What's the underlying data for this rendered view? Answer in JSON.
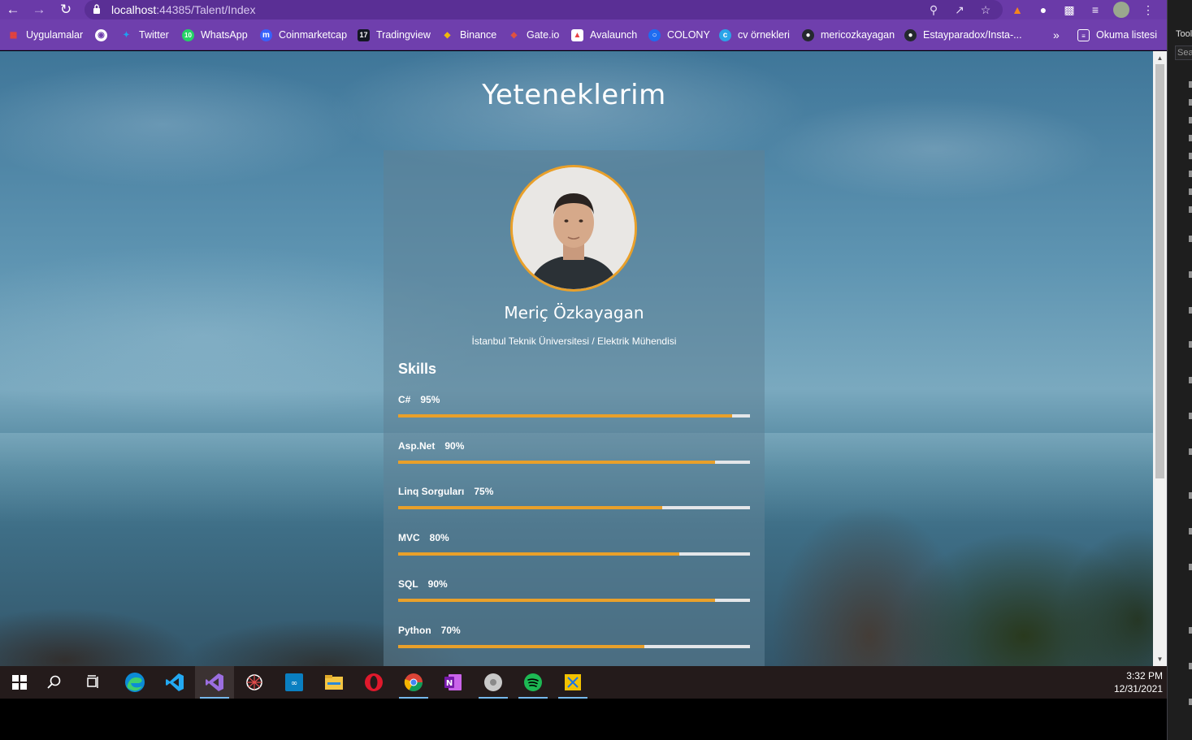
{
  "browser": {
    "url_host": "localhost",
    "url_rest": ":44385/Talent/Index",
    "bookmarks": [
      {
        "label": "Uygulamalar",
        "icon": "apps-grid-icon",
        "color": "#ea4335"
      },
      {
        "label": "",
        "icon": "globe-icon",
        "color": "#ffffff"
      },
      {
        "label": "Twitter",
        "icon": "twitter-icon",
        "color": "#1da1f2"
      },
      {
        "label": "WhatsApp",
        "icon": "whatsapp-icon",
        "color": "#25d366"
      },
      {
        "label": "Coinmarketcap",
        "icon": "coinmarketcap-icon",
        "color": "#3861fb"
      },
      {
        "label": "Tradingview",
        "icon": "tradingview-icon",
        "color": "#131722"
      },
      {
        "label": "Binance",
        "icon": "binance-icon",
        "color": "#f0b90b"
      },
      {
        "label": "Gate.io",
        "icon": "gateio-icon",
        "color": "#e0513f"
      },
      {
        "label": "Avalaunch",
        "icon": "avalaunch-icon",
        "color": "#e84142"
      },
      {
        "label": "COLONY",
        "icon": "colony-icon",
        "color": "#1e6cf1"
      },
      {
        "label": "cv örnekleri",
        "icon": "cv-site-icon",
        "color": "#2aa4e8"
      },
      {
        "label": "mericozkayagan",
        "icon": "github-icon",
        "color": "#24292e"
      },
      {
        "label": "Estayparadox/Insta-...",
        "icon": "github-icon",
        "color": "#24292e"
      }
    ],
    "overflow_label": "»",
    "reading_list_label": "Okuma listesi"
  },
  "page": {
    "title": "Yeteneklerim",
    "profile": {
      "name": "Meriç Özkayagan",
      "description": "İstanbul Teknik Üniversitesi / Elektrik Mühendisi"
    },
    "skills_heading": "Skills",
    "skills": [
      {
        "name": "C#",
        "percent_label": "95%",
        "percent": 95
      },
      {
        "name": "Asp.Net",
        "percent_label": "90%",
        "percent": 90
      },
      {
        "name": "Linq Sorguları",
        "percent_label": "75%",
        "percent": 75
      },
      {
        "name": "MVC",
        "percent_label": "80%",
        "percent": 80
      },
      {
        "name": "SQL",
        "percent_label": "90%",
        "percent": 90
      },
      {
        "name": "Python",
        "percent_label": "70%",
        "percent": 70
      }
    ],
    "accent_color": "#e9a02a"
  },
  "ide_panel": {
    "tool_label": "Tool",
    "search_placeholder": "Sear"
  },
  "taskbar": {
    "apps": [
      "windows-start-icon",
      "search-icon",
      "task-view-icon",
      "edge-icon",
      "vscode-icon",
      "visual-studio-icon",
      "settings-web-icon",
      "arduino-icon",
      "file-explorer-icon",
      "opera-icon",
      "chrome-icon",
      "onenote-icon",
      "media-icon",
      "spotify-icon",
      "snip-tool-icon"
    ],
    "time": "3:32 PM",
    "date": "12/31/2021"
  }
}
